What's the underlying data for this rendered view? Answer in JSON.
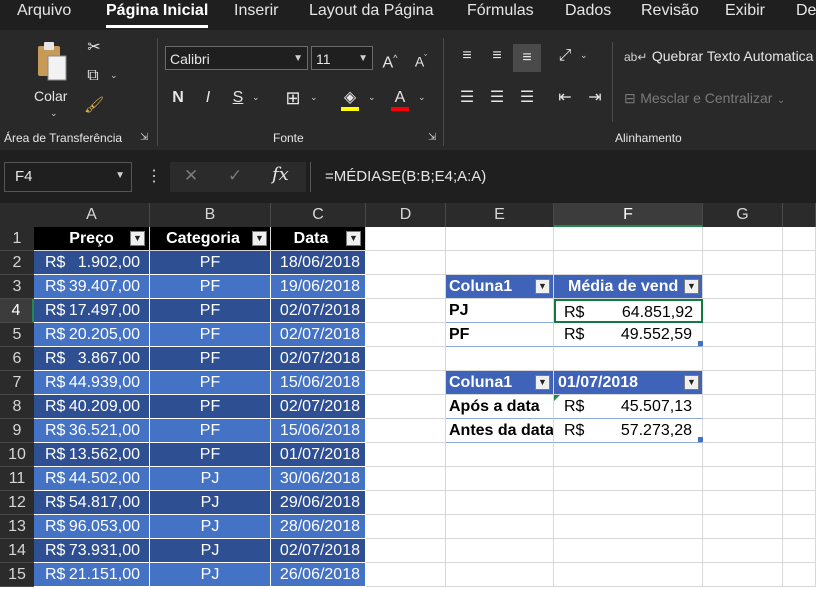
{
  "menu": {
    "tabs": [
      "Arquivo",
      "Página Inicial",
      "Inserir",
      "Layout da Página",
      "Fórmulas",
      "Dados",
      "Revisão",
      "Exibir",
      "De"
    ]
  },
  "ribbon": {
    "paste_label": "Colar",
    "clipboard_group": "Área de Transferência",
    "font_name": "Calibri",
    "font_size": "11",
    "bold": "N",
    "italic": "I",
    "underline": "S",
    "font_group": "Fonte",
    "wrap_text": "Quebrar Texto Automatica",
    "merge_center": "Mesclar e Centralizar",
    "alignment_group": "Alinhamento",
    "colors": {
      "highlight": "#ffff00",
      "font_color": "#ff0000"
    }
  },
  "formula_bar": {
    "name_box": "F4",
    "fx": "fx",
    "formula": "=MÉDIASE(B:B;E4;A:A)"
  },
  "grid": {
    "columns": [
      "A",
      "B",
      "C",
      "D",
      "E",
      "F",
      "G"
    ],
    "rows": [
      "1",
      "2",
      "3",
      "4",
      "5",
      "6",
      "7",
      "8",
      "9",
      "10",
      "11",
      "12",
      "13",
      "14",
      "15"
    ],
    "selected_cell": "F4"
  },
  "table1": {
    "headers": [
      "Preço",
      "Categoria",
      "Data"
    ],
    "rows": [
      {
        "cur": "R$",
        "val": "1.902,00",
        "cat": "PF",
        "date": "18/06/2018"
      },
      {
        "cur": "R$",
        "val": "39.407,00",
        "cat": "PF",
        "date": "19/06/2018"
      },
      {
        "cur": "R$",
        "val": "17.497,00",
        "cat": "PF",
        "date": "02/07/2018"
      },
      {
        "cur": "R$",
        "val": "20.205,00",
        "cat": "PF",
        "date": "02/07/2018"
      },
      {
        "cur": "R$",
        "val": "3.867,00",
        "cat": "PF",
        "date": "02/07/2018"
      },
      {
        "cur": "R$",
        "val": "44.939,00",
        "cat": "PF",
        "date": "15/06/2018"
      },
      {
        "cur": "R$",
        "val": "40.209,00",
        "cat": "PF",
        "date": "02/07/2018"
      },
      {
        "cur": "R$",
        "val": "36.521,00",
        "cat": "PF",
        "date": "15/06/2018"
      },
      {
        "cur": "R$",
        "val": "13.562,00",
        "cat": "PF",
        "date": "01/07/2018"
      },
      {
        "cur": "R$",
        "val": "44.502,00",
        "cat": "PJ",
        "date": "30/06/2018"
      },
      {
        "cur": "R$",
        "val": "54.817,00",
        "cat": "PJ",
        "date": "29/06/2018"
      },
      {
        "cur": "R$",
        "val": "96.053,00",
        "cat": "PJ",
        "date": "28/06/2018"
      },
      {
        "cur": "R$",
        "val": "73.931,00",
        "cat": "PJ",
        "date": "02/07/2018"
      },
      {
        "cur": "R$",
        "val": "21.151,00",
        "cat": "PJ",
        "date": "26/06/2018"
      }
    ]
  },
  "table2": {
    "headers": [
      "Coluna1",
      "Média de vend"
    ],
    "rows": [
      {
        "label": "PJ",
        "cur": "R$",
        "val": "64.851,92"
      },
      {
        "label": "PF",
        "cur": "R$",
        "val": "49.552,59"
      }
    ]
  },
  "table3": {
    "headers": [
      "Coluna1",
      "01/07/2018"
    ],
    "rows": [
      {
        "label": "Após a data",
        "cur": "R$",
        "val": "45.507,13"
      },
      {
        "label": "Antes da data",
        "cur": "R$",
        "val": "57.273,28"
      }
    ]
  }
}
